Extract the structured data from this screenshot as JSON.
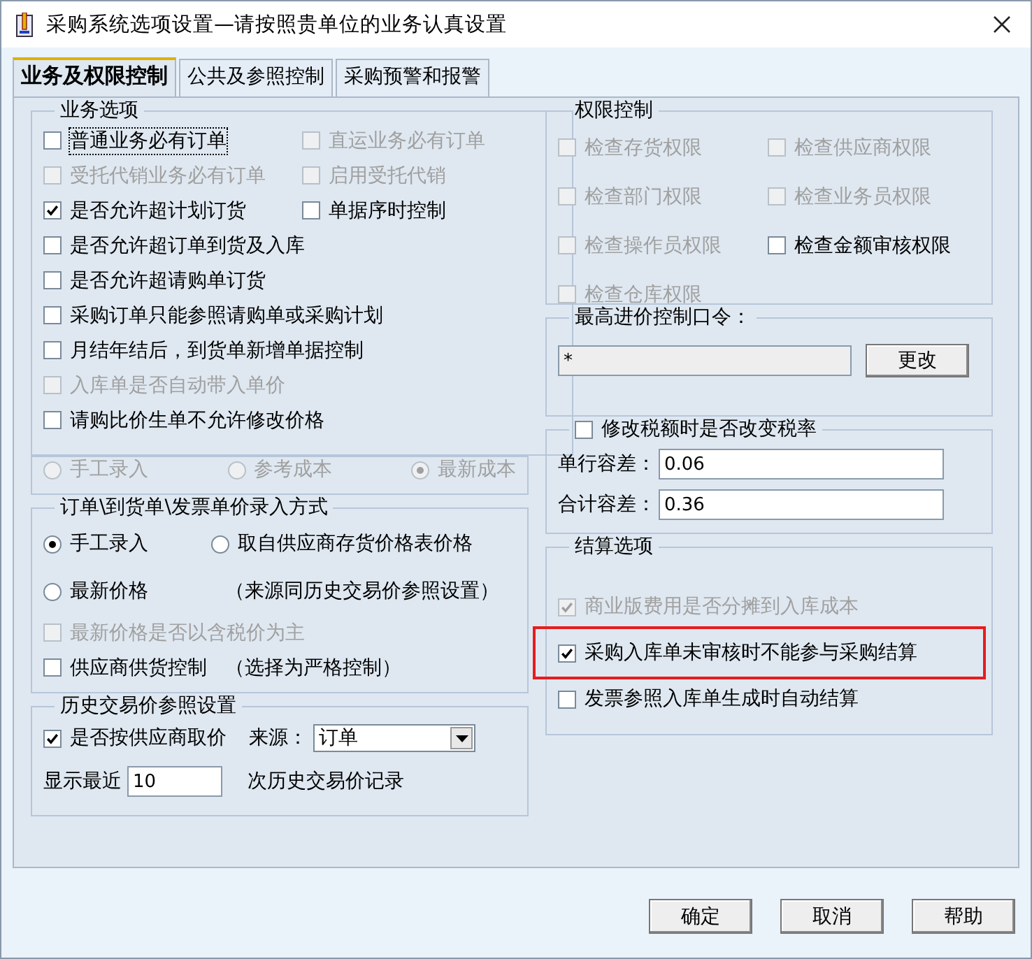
{
  "window": {
    "title": "采购系统选项设置—请按照贵单位的业务认真设置"
  },
  "tabs": [
    {
      "label": "业务及权限控制",
      "selected": true
    },
    {
      "label": "公共及参照控制",
      "selected": false
    },
    {
      "label": "采购预警和报警",
      "selected": false
    }
  ],
  "business_options": {
    "title": "业务选项",
    "rows": [
      [
        {
          "kind": "checkbox",
          "label": "普通业务必有订单",
          "checked": false,
          "disabled": false,
          "focused": true
        },
        {
          "kind": "checkbox",
          "label": "直运业务必有订单",
          "checked": false,
          "disabled": true,
          "focused": false
        }
      ],
      [
        {
          "kind": "checkbox",
          "label": "受托代销业务必有订单",
          "checked": false,
          "disabled": true,
          "focused": false
        },
        {
          "kind": "checkbox",
          "label": "启用受托代销",
          "checked": false,
          "disabled": true,
          "focused": false
        }
      ],
      [
        {
          "kind": "checkbox",
          "label": "是否允许超计划订货",
          "checked": true,
          "disabled": false,
          "focused": false
        },
        {
          "kind": "checkbox",
          "label": "单据序时控制",
          "checked": false,
          "disabled": false,
          "focused": false
        }
      ],
      [
        {
          "kind": "checkbox",
          "label": "是否允许超订单到货及入库",
          "checked": false,
          "disabled": false,
          "focused": false
        }
      ],
      [
        {
          "kind": "checkbox",
          "label": "是否允许超请购单订货",
          "checked": false,
          "disabled": false,
          "focused": false
        }
      ],
      [
        {
          "kind": "checkbox",
          "label": "采购订单只能参照请购单或采购计划",
          "checked": false,
          "disabled": false,
          "focused": false
        }
      ],
      [
        {
          "kind": "checkbox",
          "label": "月结年结后，到货单新增单据控制",
          "checked": false,
          "disabled": false,
          "focused": false
        }
      ],
      [
        {
          "kind": "checkbox",
          "label": "入库单是否自动带入单价",
          "checked": false,
          "disabled": true,
          "focused": false
        }
      ],
      [
        {
          "kind": "checkbox",
          "label": "请购比价生单不允许修改价格",
          "checked": false,
          "disabled": false,
          "focused": false
        }
      ]
    ]
  },
  "cost_method": {
    "rows": [
      [
        {
          "kind": "radio",
          "label": "手工录入",
          "selected": false,
          "disabled": true
        },
        {
          "kind": "radio",
          "label": "参考成本",
          "selected": false,
          "disabled": true
        },
        {
          "kind": "radio",
          "label": "最新成本",
          "selected": true,
          "disabled": true
        }
      ]
    ]
  },
  "price_entry": {
    "title": "订单\\到货单\\发票单价录入方式",
    "rows": [
      [
        {
          "kind": "radio",
          "label": "手工录入",
          "selected": true,
          "disabled": false
        },
        {
          "kind": "radio",
          "label": "取自供应商存货价格表价格",
          "selected": false,
          "disabled": false
        }
      ],
      [
        {
          "kind": "radio",
          "label": "最新价格",
          "selected": false,
          "disabled": false
        },
        {
          "kind": "note",
          "label": "（来源同历史交易价参照设置）"
        }
      ],
      [
        {
          "kind": "checkbox",
          "label": "最新价格是否以含税价为主",
          "checked": false,
          "disabled": true
        }
      ],
      [
        {
          "kind": "checkbox",
          "label": "供应商供货控制",
          "checked": false,
          "disabled": false
        },
        {
          "kind": "note",
          "label": "（选择为严格控制）"
        }
      ]
    ]
  },
  "history": {
    "title": "历史交易价参照设置",
    "by_supplier": {
      "label": "是否按供应商取价",
      "checked": true
    },
    "source_label": "来源：",
    "source_value": "订单",
    "show_prefix": "显示最近",
    "count": "10",
    "show_suffix": "次历史交易价记录"
  },
  "permissions": {
    "title": "权限控制",
    "rows": [
      [
        {
          "kind": "checkbox",
          "label": "检查存货权限",
          "checked": false,
          "disabled": true
        },
        {
          "kind": "checkbox",
          "label": "检查供应商权限",
          "checked": false,
          "disabled": true
        }
      ],
      [
        {
          "kind": "checkbox",
          "label": "检查部门权限",
          "checked": false,
          "disabled": true
        },
        {
          "kind": "checkbox",
          "label": "检查业务员权限",
          "checked": false,
          "disabled": true
        }
      ],
      [
        {
          "kind": "checkbox",
          "label": "检查操作员权限",
          "checked": false,
          "disabled": true
        },
        {
          "kind": "checkbox",
          "label": "检查金额审核权限",
          "checked": false,
          "disabled": false
        }
      ],
      [
        {
          "kind": "checkbox",
          "label": "检查仓库权限",
          "checked": false,
          "disabled": true
        }
      ]
    ]
  },
  "max_price": {
    "title": "最高进价控制口令：",
    "value": "*",
    "button": "更改"
  },
  "tax": {
    "checkbox": {
      "label": "修改税额时是否改变税率",
      "checked": false
    },
    "fields": [
      {
        "label": "单行容差：",
        "value": "0.06"
      },
      {
        "label": "合计容差：",
        "value": "0.36"
      }
    ]
  },
  "settlement": {
    "title": "结算选项",
    "items": [
      {
        "kind": "checkbox",
        "label": "商业版费用是否分摊到入库成本",
        "checked": true,
        "disabled": true,
        "highlighted": false
      },
      {
        "kind": "checkbox",
        "label": "采购入库单未审核时不能参与采购结算",
        "checked": true,
        "disabled": false,
        "highlighted": true
      },
      {
        "kind": "checkbox",
        "label": "发票参照入库单生成时自动结算",
        "checked": false,
        "disabled": false,
        "highlighted": false
      }
    ]
  },
  "buttons": [
    "确定",
    "取消",
    "帮助"
  ]
}
